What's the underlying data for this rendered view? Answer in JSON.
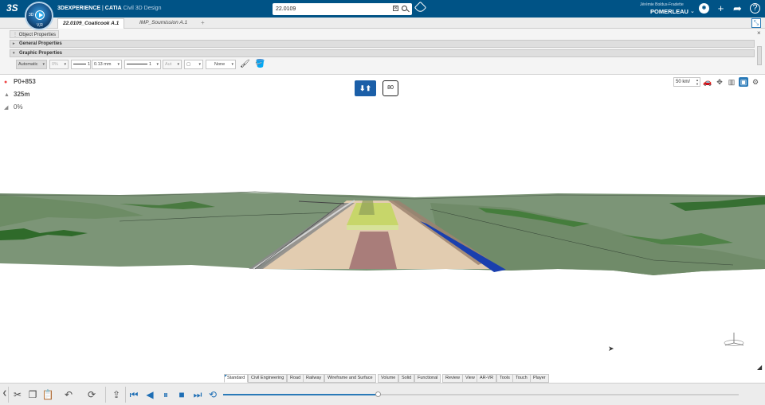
{
  "app": {
    "brand_bold": "3DEXPERIENCE",
    "brand_sep": " | ",
    "brand_app": "CATIA",
    "brand_role": " Civil 3D Design",
    "compass_left": "3D",
    "compass_bottom": "V,R"
  },
  "search": {
    "value": "22.0109",
    "clear_glyph": "⊠"
  },
  "user": {
    "name": "Jérémie Boldus-Fradette",
    "tenant": "POMERLEAU"
  },
  "tabs": [
    {
      "label": "22.0109_Coaticook A.1",
      "active": true
    },
    {
      "label": "IMP_Soumission A.1",
      "active": false
    }
  ],
  "tab_add": "+",
  "properties": {
    "header": "Object Properties",
    "close_glyph": "×",
    "sections": [
      "General Properties",
      "Graphic Properties"
    ],
    "toolbar": {
      "color_mode": "Automatic",
      "transparency": "0%",
      "line_type": "1",
      "line_weight": "0.13 mm",
      "line_type2": "1",
      "point_symbol": "Aut",
      "layer_glyph": "▢",
      "layer": "None"
    }
  },
  "hud": {
    "station": "P0+853",
    "elevation": "325m",
    "grade": "0%",
    "direction_glyph": "⬇⬆",
    "speed_sign": "80",
    "speed_limit": "50 km/"
  },
  "command_tabs": [
    "Standard",
    "Civil Engineering",
    "Road",
    "Railway",
    "Wireframe and Surface",
    "Volume",
    "Solid",
    "Functional",
    "Review",
    "View",
    "AR-VR",
    "Tools",
    "Touch",
    "Player"
  ],
  "active_command_tab": "Standard",
  "player": {
    "progress": 0.3
  },
  "colors": {
    "topbar": "#005386",
    "terrain": "#7c9577",
    "terrain_dark": "#2f6a2a",
    "pavement_center": "#a97d7a",
    "pavement_side": "#e2ccb0",
    "shoulder_yellow": "#c7d66a",
    "ditch_blue": "#1a3fae",
    "accent": "#2a7ab8"
  }
}
